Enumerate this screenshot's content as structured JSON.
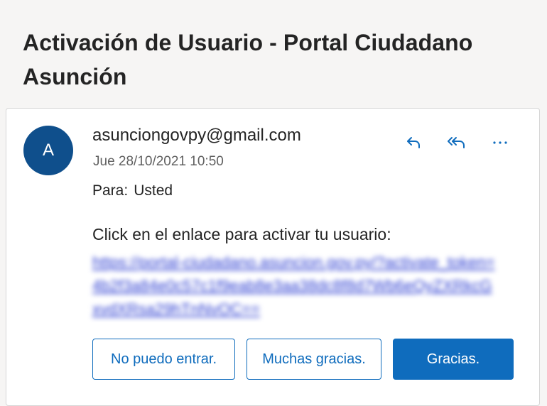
{
  "email": {
    "subject": "Activación de Usuario - Portal Ciudadano Asunción",
    "avatar_initial": "A",
    "sender": "asunciongovpy@gmail.com",
    "date": "Jue 28/10/2021 10:50",
    "to_label": "Para:",
    "to_value": "Usted",
    "body_text": "Click en el enlace para activar tu usuario:",
    "link_text": "https://portal-ciudadano.asuncion.gov.py/?activate_token=4b2f3a84e0c57c1f9eab8e3aa38dc8f8d7Wb6eQyZXRkcGxvdXRsa29hTnNvOC==",
    "quick_replies": [
      "No puedo entrar.",
      "Muchas gracias.",
      "Gracias."
    ]
  },
  "icons": {
    "reply": "reply-icon",
    "reply_all": "reply-all-icon",
    "more": "more-icon"
  },
  "colors": {
    "accent": "#0f6cbd",
    "avatar": "#0f4f8c",
    "link": "#2a3bd1"
  }
}
